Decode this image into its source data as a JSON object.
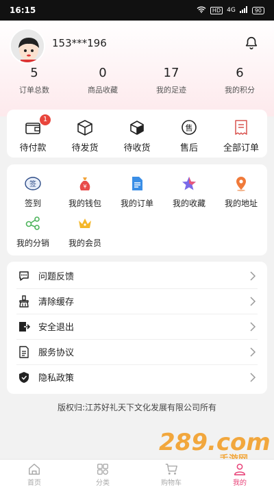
{
  "status_bar": {
    "time": "16:15",
    "hd": "HD",
    "net": "4G",
    "battery": "90"
  },
  "profile": {
    "username": "153***196"
  },
  "stats": [
    {
      "value": "5",
      "label": "订单总数"
    },
    {
      "value": "0",
      "label": "商品收藏"
    },
    {
      "value": "17",
      "label": "我的足迹"
    },
    {
      "value": "6",
      "label": "我的积分"
    }
  ],
  "orders": {
    "badge_count": "1",
    "items": [
      {
        "label": "待付款",
        "icon": "wallet-icon"
      },
      {
        "label": "待发货",
        "icon": "box-icon"
      },
      {
        "label": "待收货",
        "icon": "truck-icon"
      },
      {
        "label": "售后",
        "icon": "after-sale-icon"
      },
      {
        "label": "全部订单",
        "icon": "receipt-icon"
      }
    ]
  },
  "services": {
    "items": [
      {
        "label": "签到",
        "icon": "sign-in-icon"
      },
      {
        "label": "我的钱包",
        "icon": "money-bag-icon"
      },
      {
        "label": "我的订单",
        "icon": "document-icon"
      },
      {
        "label": "我的收藏",
        "icon": "star-icon"
      },
      {
        "label": "我的地址",
        "icon": "location-icon"
      },
      {
        "label": "我的分销",
        "icon": "share-icon"
      },
      {
        "label": "我的会员",
        "icon": "crown-icon"
      }
    ],
    "sign_glyph": "签"
  },
  "menu": {
    "items": [
      {
        "label": "问题反馈",
        "icon": "feedback-icon"
      },
      {
        "label": "清除缓存",
        "icon": "brush-icon"
      },
      {
        "label": "安全退出",
        "icon": "logout-icon"
      },
      {
        "label": "服务协议",
        "icon": "agreement-icon"
      },
      {
        "label": "隐私政策",
        "icon": "shield-icon"
      }
    ]
  },
  "copyright": "版权归:江苏好礼天下文化发展有限公司所有",
  "watermark": {
    "text": "289.com",
    "sub": "手游网"
  },
  "tabbar": {
    "items": [
      {
        "label": "首页",
        "icon": "home-icon"
      },
      {
        "label": "分类",
        "icon": "category-icon"
      },
      {
        "label": "购物车",
        "icon": "cart-icon"
      },
      {
        "label": "我的",
        "icon": "user-icon"
      }
    ],
    "active_index": 3
  },
  "colors": {
    "accent": "#e8457a",
    "badge": "#e8453c",
    "header_gradient_end": "#fde9ec"
  }
}
